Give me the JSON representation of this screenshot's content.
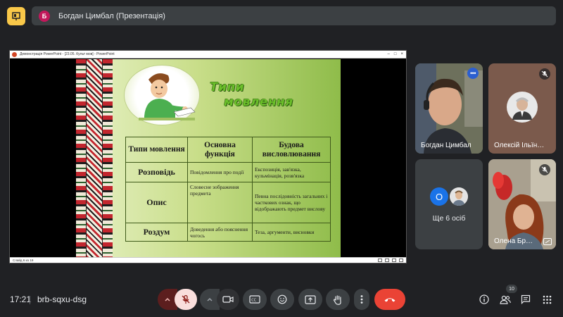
{
  "header": {
    "logo_icon": "presentation-icon",
    "avatar_letter": "Б",
    "title": "Богдан Цимбал (Презентація)"
  },
  "presentation": {
    "window_title": "Демонстрація PowerPoint - [23.05. Культ мов] - PowerPoint",
    "slide_status": "Слайд 6 из 19",
    "slide": {
      "title_line1": "Типи",
      "title_line2": "мовлення",
      "table": {
        "headers": [
          "Типи мовлення",
          "Основна функція",
          "Будова висловлювання"
        ],
        "rows": [
          {
            "name": "Розповідь",
            "function": "Повідомлення про події",
            "structure": "Експозиція, зав'язка, кульмінація, розв'язка"
          },
          {
            "name": "Опис",
            "function": "Словесне зображення предмета",
            "structure": "Певна послідовність загальних і часткових ознак, що відображають предмет вислову"
          },
          {
            "name": "Роздум",
            "function": "Доведення або пояснення чогось",
            "structure": "Теза, аргументи, висновки"
          }
        ]
      }
    }
  },
  "participants": {
    "tiles": [
      {
        "name": "Богдан Цимбал",
        "badge_icon": "more-options-icon"
      },
      {
        "name": "Олексій Ільїн…",
        "badge_icon": "mic-off-icon"
      },
      {
        "name": "Олена Бр…",
        "badge_icon": "mic-off-icon"
      }
    ],
    "others": {
      "avatar_letter": "О",
      "label": "Ще 6 осіб"
    }
  },
  "bottom_bar": {
    "time": "17:21",
    "meeting_code": "brb-sqxu-dsg",
    "participant_count": "10",
    "colors": {
      "end_call": "#ea4335",
      "mic_off_bg": "#f9dedc"
    }
  }
}
